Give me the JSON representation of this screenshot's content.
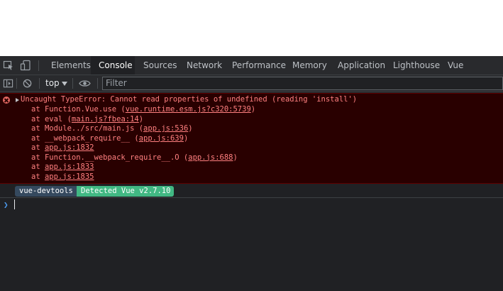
{
  "devtools": {
    "tabs": [
      {
        "label": "Elements"
      },
      {
        "label": "Console"
      },
      {
        "label": "Sources"
      },
      {
        "label": "Network"
      },
      {
        "label": "Performance"
      },
      {
        "label": "Memory"
      },
      {
        "label": "Application"
      },
      {
        "label": "Lighthouse"
      },
      {
        "label": "Vue"
      }
    ],
    "active_tab": "Console"
  },
  "console_toolbar": {
    "context": "top",
    "filter_placeholder": "Filter"
  },
  "error": {
    "message": "Uncaught TypeError: Cannot read properties of undefined (reading 'install')",
    "stack": [
      {
        "prefix": "at Function.Vue.use (",
        "link": "vue.runtime.esm.js?c320:5739",
        "suffix": ")"
      },
      {
        "prefix": "at eval (",
        "link": "main.js?fbea:14",
        "suffix": ")"
      },
      {
        "prefix": "at Module../src/main.js (",
        "link": "app.js:536",
        "suffix": ")"
      },
      {
        "prefix": "at __webpack_require__ (",
        "link": "app.js:639",
        "suffix": ")"
      },
      {
        "prefix": "at ",
        "link": "app.js:1832",
        "suffix": ""
      },
      {
        "prefix": "at Function.__webpack_require__.O (",
        "link": "app.js:688",
        "suffix": ")"
      },
      {
        "prefix": "at ",
        "link": "app.js:1833",
        "suffix": ""
      },
      {
        "prefix": "at ",
        "link": "app.js:1835",
        "suffix": ""
      }
    ]
  },
  "vue_devtools": {
    "label": "vue-devtools",
    "status": "Detected Vue v2.7.10"
  },
  "colors": {
    "error_text": "#ff8080",
    "error_bg": "#290000",
    "vue_dark": "#35495e",
    "vue_green": "#41b883"
  }
}
